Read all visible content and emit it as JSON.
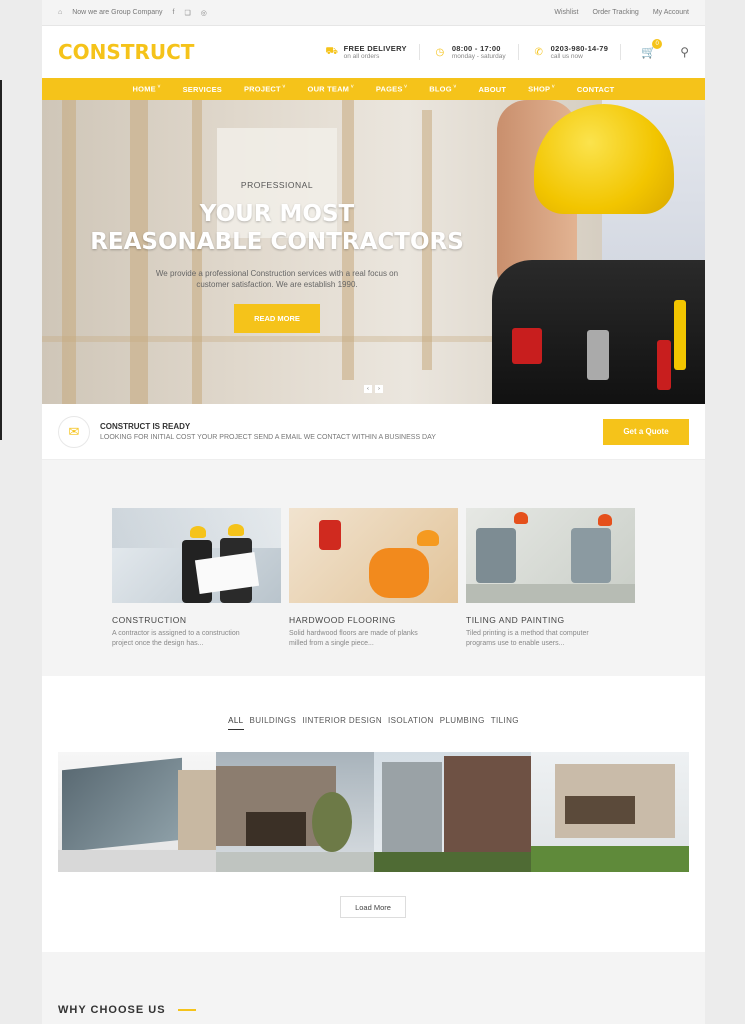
{
  "topbar": {
    "tagline": "Now we are Group Company",
    "social": [
      "facebook-icon",
      "twitter-icon",
      "instagram-icon"
    ],
    "links": [
      "Wishlist",
      "Order Tracking",
      "My Account"
    ]
  },
  "header": {
    "logo": "CONSTRUCT",
    "delivery_title": "FREE DELIVERY",
    "delivery_sub": "on all orders",
    "hours_title": "08:00 - 17:00",
    "hours_sub": "monday - saturday",
    "phone_title": "0203-980-14-79",
    "phone_sub": "call us now",
    "cart_count": "0"
  },
  "nav": {
    "items": [
      {
        "label": "HOME",
        "dropdown": true
      },
      {
        "label": "SERVICES",
        "dropdown": false
      },
      {
        "label": "PROJECT",
        "dropdown": true
      },
      {
        "label": "OUR TEAM",
        "dropdown": true
      },
      {
        "label": "PAGES",
        "dropdown": true
      },
      {
        "label": "BLOG",
        "dropdown": true
      },
      {
        "label": "ABOUT",
        "dropdown": false
      },
      {
        "label": "SHOP",
        "dropdown": true
      },
      {
        "label": "CONTACT",
        "dropdown": false
      }
    ]
  },
  "hero": {
    "pretitle": "PROFESSIONAL",
    "title_line1": "YOUR MOST",
    "title_line2": "REASONABLE CONTRACTORS",
    "desc_line1": "We provide a professional Construction services with a real focus on",
    "desc_line2": "customer satisfaction. We are establish 1990.",
    "button": "READ MORE",
    "prev": "‹",
    "next": "›"
  },
  "quote": {
    "title": "CONSTRUCT IS READY",
    "text": "LOOKING FOR INITIAL COST YOUR PROJECT SEND A EMAIL WE CONTACT WITHIN A BUSINESS DAY",
    "button": "Get a Quote"
  },
  "services": [
    {
      "title": "CONSTRUCTION",
      "line1": "A contractor is assigned to a construction",
      "line2": "project once the design has..."
    },
    {
      "title": "HARDWOOD FLOORING",
      "line1": "Solid hardwood floors are made of planks",
      "line2": "milled from a single piece..."
    },
    {
      "title": "TILING AND PAINTING",
      "line1": "Tiled printing is a method that computer",
      "line2": "programs use to enable users..."
    }
  ],
  "projects": {
    "tabs": [
      "ALL",
      "BUILDINGS",
      "IINTERIOR DESIGN",
      "ISOLATION",
      "PLUMBING",
      "TILING"
    ],
    "load_more": "Load More"
  },
  "why": {
    "title": "WHY CHOOSE US"
  },
  "colors": {
    "accent": "#f5c31a",
    "text": "#444444",
    "background": "#f4f4f4"
  }
}
